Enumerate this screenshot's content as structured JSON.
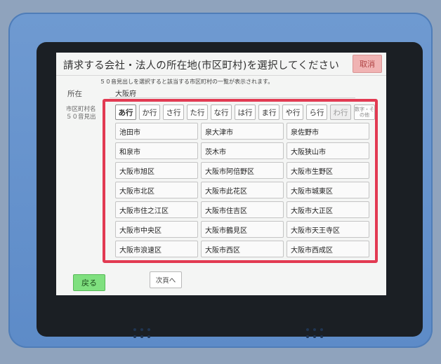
{
  "screen": {
    "title": "請求する会社・法人の所在地(市区町村)を選択してください",
    "cancel_label": "取消",
    "info": "５０音見出しを選択すると該当する市区町村の一覧が表示されます。",
    "location_label": "所在",
    "location_value": "大阪府",
    "city_label_line1": "市区町村名",
    "city_label_line2": "５０音見出"
  },
  "kana_tabs": [
    {
      "label": "あ行",
      "state": "active"
    },
    {
      "label": "か行",
      "state": "normal"
    },
    {
      "label": "さ行",
      "state": "normal"
    },
    {
      "label": "た行",
      "state": "normal"
    },
    {
      "label": "な行",
      "state": "normal"
    },
    {
      "label": "は行",
      "state": "normal"
    },
    {
      "label": "ま行",
      "state": "normal"
    },
    {
      "label": "や行",
      "state": "normal"
    },
    {
      "label": "ら行",
      "state": "normal"
    },
    {
      "label": "わ行",
      "state": "disabled"
    },
    {
      "label": "数字・その他",
      "state": "misc"
    }
  ],
  "cities": [
    "池田市",
    "泉大津市",
    "泉佐野市",
    "和泉市",
    "茨木市",
    "大阪狭山市",
    "大阪市旭区",
    "大阪市阿倍野区",
    "大阪市生野区",
    "大阪市北区",
    "大阪市此花区",
    "大阪市城東区",
    "大阪市住之江区",
    "大阪市住吉区",
    "大阪市大正区",
    "大阪市中央区",
    "大阪市鶴見区",
    "大阪市天王寺区",
    "大阪市浪速区",
    "大阪市西区",
    "大阪市西成区"
  ],
  "footer": {
    "back_label": "戻る",
    "next_label": "次頁へ"
  },
  "colors": {
    "highlight": "#e23a52",
    "back_button": "#7fe07f",
    "cancel_button": "#f0b3b3",
    "bezel": "#6f9ad1"
  }
}
